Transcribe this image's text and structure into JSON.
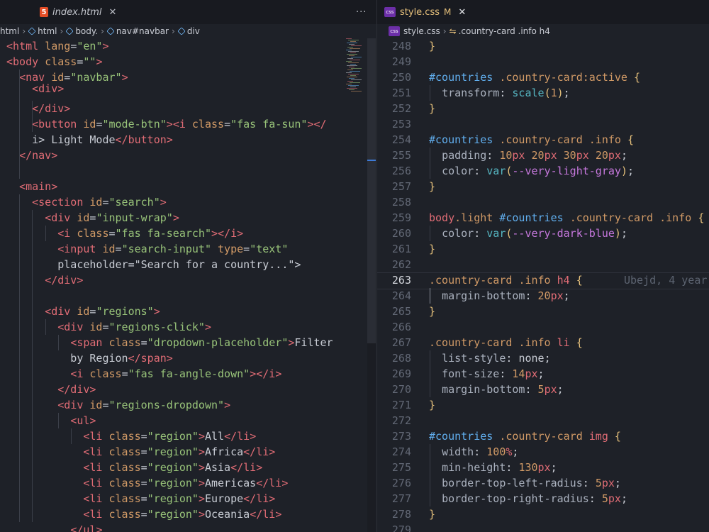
{
  "left_editor": {
    "tab": {
      "name": "index.html",
      "icon": "html5-icon",
      "badge": "5"
    },
    "more_actions": "···",
    "close_glyph": "✕",
    "breadcrumb": [
      "html",
      "html",
      "body.",
      "nav#navbar",
      "div"
    ]
  },
  "right_editor": {
    "tab": {
      "name": "style.css",
      "status": "M",
      "icon": "css-file-icon",
      "badge": "css"
    },
    "close_glyph": "✕",
    "breadcrumb": {
      "file": "style.css",
      "symbol": ".country-card .info h4"
    }
  },
  "blame": "Ubejd, 4 year",
  "html_lines": [
    "<html lang=\"en\">",
    "<body class=\"\">",
    "  <nav id=\"navbar\">",
    "    <div>",
    "    </div>",
    "    <button id=\"mode-btn\"><i class=\"fas fa-sun\"></",
    "    i> Light Mode</button>",
    "  </nav>",
    "",
    "  <main>",
    "    <section id=\"search\">",
    "      <div id=\"input-wrap\">",
    "        <i class=\"fas fa-search\"></i>",
    "        <input id=\"search-input\" type=\"text\"",
    "        placeholder=\"Search for a country...\">",
    "      </div>",
    "",
    "      <div id=\"regions\">",
    "        <div id=\"regions-click\">",
    "          <span class=\"dropdown-placeholder\">Filter",
    "          by Region</span>",
    "          <i class=\"fas fa-angle-down\"></i>",
    "        </div>",
    "        <div id=\"regions-dropdown\">",
    "          <ul>",
    "            <li class=\"region\">All</li>",
    "            <li class=\"region\">Africa</li>",
    "            <li class=\"region\">Asia</li>",
    "            <li class=\"region\">Americas</li>",
    "            <li class=\"region\">Europe</li>",
    "            <li class=\"region\">Oceania</li>",
    "          </ul>"
  ],
  "css_lines": [
    {
      "n": "248",
      "text": "}"
    },
    {
      "n": "249",
      "text": ""
    },
    {
      "n": "250",
      "text": "#countries .country-card:active {"
    },
    {
      "n": "251",
      "text": "  transform: scale(1);"
    },
    {
      "n": "252",
      "text": "}"
    },
    {
      "n": "253",
      "text": ""
    },
    {
      "n": "254",
      "text": "#countries .country-card .info {"
    },
    {
      "n": "255",
      "text": "  padding: 10px 20px 30px 20px;"
    },
    {
      "n": "256",
      "text": "  color: var(--very-light-gray);"
    },
    {
      "n": "257",
      "text": "}"
    },
    {
      "n": "258",
      "text": ""
    },
    {
      "n": "259",
      "text": "body.light #countries .country-card .info {"
    },
    {
      "n": "260",
      "text": "  color: var(--very-dark-blue);"
    },
    {
      "n": "261",
      "text": "}"
    },
    {
      "n": "262",
      "text": ""
    },
    {
      "n": "263",
      "text": ".country-card .info h4 {"
    },
    {
      "n": "264",
      "text": "  margin-bottom: 20px;"
    },
    {
      "n": "265",
      "text": "}"
    },
    {
      "n": "266",
      "text": ""
    },
    {
      "n": "267",
      "text": ".country-card .info li {"
    },
    {
      "n": "268",
      "text": "  list-style: none;"
    },
    {
      "n": "269",
      "text": "  font-size: 14px;"
    },
    {
      "n": "270",
      "text": "  margin-bottom: 5px;"
    },
    {
      "n": "271",
      "text": "}"
    },
    {
      "n": "272",
      "text": ""
    },
    {
      "n": "273",
      "text": "#countries .country-card img {"
    },
    {
      "n": "274",
      "text": "  width: 100%;"
    },
    {
      "n": "275",
      "text": "  min-height: 130px;"
    },
    {
      "n": "276",
      "text": "  border-top-left-radius: 5px;"
    },
    {
      "n": "277",
      "text": "  border-top-right-radius: 5px;"
    },
    {
      "n": "278",
      "text": "}"
    },
    {
      "n": "279",
      "text": ""
    }
  ],
  "active_css_line": "263",
  "colors": {
    "tag": "#e06c75",
    "attribute": "#d19a66",
    "string": "#98c379",
    "id_selector": "#61afef",
    "class_selector": "#d19a66",
    "number": "#d19a66",
    "function": "#56b6c2",
    "variable": "#c678dd",
    "bracket": "#e5c07b",
    "background": "#1e2128"
  }
}
